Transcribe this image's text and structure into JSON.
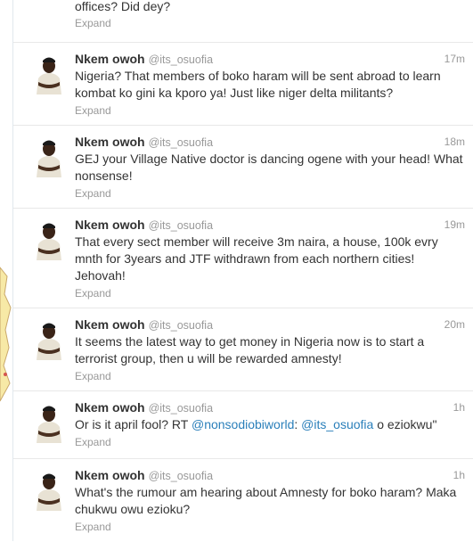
{
  "partial_tweet": {
    "text": "offices? Did dey?",
    "expand_label": "Expand"
  },
  "tweets": [
    {
      "name": "Nkem owoh",
      "screen_name": "@its_osuofia",
      "time": "17m",
      "text": "Nigeria? That members of boko haram will be sent abroad to learn kombat ko gini ka kporo ya! Just like niger delta militants?",
      "expand_label": "Expand"
    },
    {
      "name": "Nkem owoh",
      "screen_name": "@its_osuofia",
      "time": "18m",
      "text": "GEJ your Village Native doctor is dancing ogene with your head! What nonsense!",
      "expand_label": "Expand"
    },
    {
      "name": "Nkem owoh",
      "screen_name": "@its_osuofia",
      "time": "19m",
      "text": "That every sect member will receive 3m naira, a house, 100k evry mnth for 3years and JTF withdrawn from each northern cities! Jehovah!",
      "expand_label": "Expand"
    },
    {
      "name": "Nkem owoh",
      "screen_name": "@its_osuofia",
      "time": "20m",
      "text": "It seems the latest way to get money in Nigeria now is to start a terrorist group, then u will be rewarded amnesty!",
      "expand_label": "Expand"
    },
    {
      "name": "Nkem owoh",
      "screen_name": "@its_osuofia",
      "time": "1h",
      "text_before": "Or is it april fool? RT ",
      "mention1": "@nonsodiobiworld",
      "text_middle": ": ",
      "mention2": "@its_osuofia",
      "text_after": " o eziokwu\"",
      "expand_label": "Expand"
    },
    {
      "name": "Nkem owoh",
      "screen_name": "@its_osuofia",
      "time": "1h",
      "text": "What's the rumour am hearing about Amnesty for boko haram? Maka chukwu owu ezioku?",
      "expand_label": "Expand"
    }
  ],
  "colors": {
    "name": "#333333",
    "meta": "#999999",
    "mention": "#2a7fba",
    "divider": "#e8e8e8"
  }
}
